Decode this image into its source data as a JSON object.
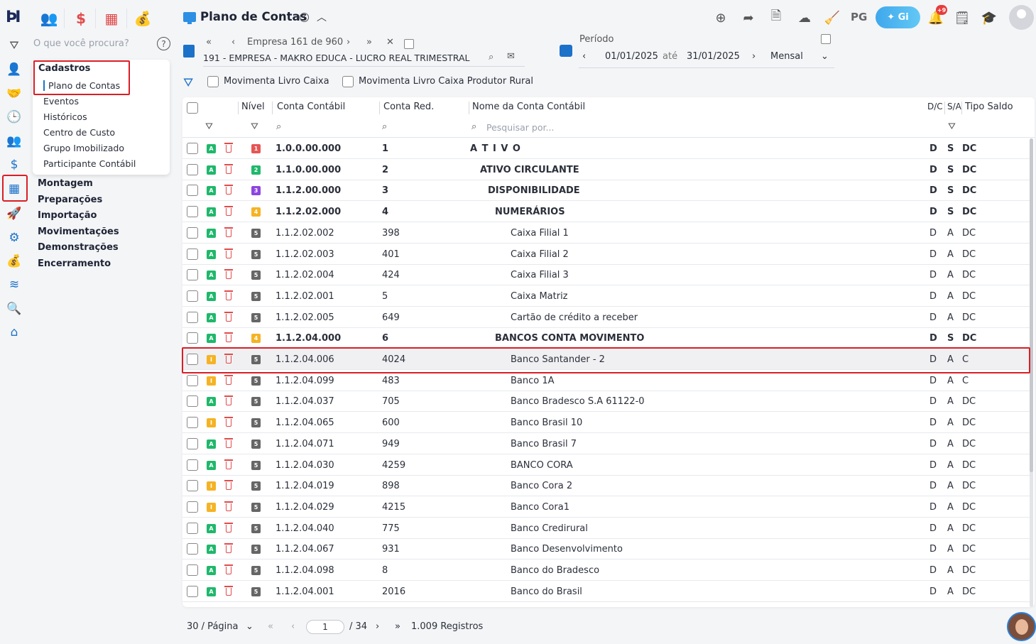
{
  "header": {
    "page_title": "Plano de Contas",
    "pg_label": "PG",
    "gi_label": "Gi",
    "notif_badge": "+9"
  },
  "sidebar": {
    "search_placeholder": "O que você procura?",
    "submenu": {
      "category": "Cadastros",
      "items": [
        "Plano de Contas",
        "Eventos",
        "Históricos",
        "Centro de Custo",
        "Grupo Imobilizado",
        "Participante Contábil"
      ]
    },
    "main_items": [
      "Montagem",
      "Preparações",
      "Importação",
      "Movimentações",
      "Demonstrações",
      "Encerramento"
    ]
  },
  "company": {
    "nav_label": "Empresa 161 de 960",
    "name": "191 - EMPRESA - MAKRO EDUCA - LUCRO REAL TRIMESTRAL"
  },
  "period": {
    "label": "Período",
    "start": "01/01/2025",
    "sep": "até",
    "end": "31/01/2025",
    "mode": "Mensal"
  },
  "filters": {
    "caixa": "Movimenta Livro Caixa",
    "caixa_rural": "Movimenta Livro Caixa Produtor Rural"
  },
  "table": {
    "headers": {
      "nivel": "Nível",
      "conta": "Conta Contábil",
      "red": "Conta Red.",
      "nome": "Nome da Conta Contábil",
      "dc": "D/C",
      "sa": "S/A",
      "tipo": "Tipo Saldo"
    },
    "search_placeholder": "Pesquisar por...",
    "rows": [
      {
        "status": "A",
        "nivel": "1",
        "conta": "1.0.0.00.000",
        "red": "1",
        "nome": "A T I V O",
        "dc": "D",
        "sa": "S",
        "tipo": "DC"
      },
      {
        "status": "A",
        "nivel": "2",
        "conta": "1.1.0.00.000",
        "red": "2",
        "nome": "ATIVO CIRCULANTE",
        "dc": "D",
        "sa": "S",
        "tipo": "DC"
      },
      {
        "status": "A",
        "nivel": "3",
        "conta": "1.1.2.00.000",
        "red": "3",
        "nome": "DISPONIBILIDADE",
        "dc": "D",
        "sa": "S",
        "tipo": "DC"
      },
      {
        "status": "A",
        "nivel": "4",
        "conta": "1.1.2.02.000",
        "red": "4",
        "nome": "NUMERÁRIOS",
        "dc": "D",
        "sa": "S",
        "tipo": "DC"
      },
      {
        "status": "A",
        "nivel": "5",
        "conta": "1.1.2.02.002",
        "red": "398",
        "nome": "Caixa Filial 1",
        "dc": "D",
        "sa": "A",
        "tipo": "DC"
      },
      {
        "status": "A",
        "nivel": "5",
        "conta": "1.1.2.02.003",
        "red": "401",
        "nome": "Caixa Filial 2",
        "dc": "D",
        "sa": "A",
        "tipo": "DC"
      },
      {
        "status": "A",
        "nivel": "5",
        "conta": "1.1.2.02.004",
        "red": "424",
        "nome": "Caixa Filial 3",
        "dc": "D",
        "sa": "A",
        "tipo": "DC"
      },
      {
        "status": "A",
        "nivel": "5",
        "conta": "1.1.2.02.001",
        "red": "5",
        "nome": "Caixa Matriz",
        "dc": "D",
        "sa": "A",
        "tipo": "DC"
      },
      {
        "status": "A",
        "nivel": "5",
        "conta": "1.1.2.02.005",
        "red": "649",
        "nome": "Cartão de crédito a receber",
        "dc": "D",
        "sa": "A",
        "tipo": "DC"
      },
      {
        "status": "A",
        "nivel": "4",
        "conta": "1.1.2.04.000",
        "red": "6",
        "nome": "BANCOS CONTA MOVIMENTO",
        "dc": "D",
        "sa": "S",
        "tipo": "DC"
      },
      {
        "status": "I",
        "nivel": "5",
        "conta": "1.1.2.04.006",
        "red": "4024",
        "nome": "Banco Santander - 2",
        "dc": "D",
        "sa": "A",
        "tipo": "C"
      },
      {
        "status": "I",
        "nivel": "5",
        "conta": "1.1.2.04.099",
        "red": "483",
        "nome": "Banco 1A",
        "dc": "D",
        "sa": "A",
        "tipo": "C"
      },
      {
        "status": "A",
        "nivel": "5",
        "conta": "1.1.2.04.037",
        "red": "705",
        "nome": "Banco Bradesco S.A 61122-0",
        "dc": "D",
        "sa": "A",
        "tipo": "DC"
      },
      {
        "status": "I",
        "nivel": "5",
        "conta": "1.1.2.04.065",
        "red": "600",
        "nome": "Banco Brasil 10",
        "dc": "D",
        "sa": "A",
        "tipo": "DC"
      },
      {
        "status": "A",
        "nivel": "5",
        "conta": "1.1.2.04.071",
        "red": "949",
        "nome": "Banco Brasil 7",
        "dc": "D",
        "sa": "A",
        "tipo": "DC"
      },
      {
        "status": "A",
        "nivel": "5",
        "conta": "1.1.2.04.030",
        "red": "4259",
        "nome": "BANCO CORA",
        "dc": "D",
        "sa": "A",
        "tipo": "DC"
      },
      {
        "status": "I",
        "nivel": "5",
        "conta": "1.1.2.04.019",
        "red": "898",
        "nome": "Banco Cora 2",
        "dc": "D",
        "sa": "A",
        "tipo": "DC"
      },
      {
        "status": "I",
        "nivel": "5",
        "conta": "1.1.2.04.029",
        "red": "4215",
        "nome": "Banco Cora1",
        "dc": "D",
        "sa": "A",
        "tipo": "DC"
      },
      {
        "status": "A",
        "nivel": "5",
        "conta": "1.1.2.04.040",
        "red": "775",
        "nome": "Banco Credirural",
        "dc": "D",
        "sa": "A",
        "tipo": "DC"
      },
      {
        "status": "A",
        "nivel": "5",
        "conta": "1.1.2.04.067",
        "red": "931",
        "nome": "Banco Desenvolvimento",
        "dc": "D",
        "sa": "A",
        "tipo": "DC"
      },
      {
        "status": "A",
        "nivel": "5",
        "conta": "1.1.2.04.098",
        "red": "8",
        "nome": "Banco do Bradesco",
        "dc": "D",
        "sa": "A",
        "tipo": "DC"
      },
      {
        "status": "A",
        "nivel": "5",
        "conta": "1.1.2.04.001",
        "red": "2016",
        "nome": "Banco do Brasil",
        "dc": "D",
        "sa": "A",
        "tipo": "DC"
      }
    ]
  },
  "pagination": {
    "per_page": "30 / Página",
    "current": "1",
    "total": "/ 34",
    "records": "1.009 Registros"
  },
  "colors": {
    "accent": "#1c72c8",
    "highlight": "#d91e26",
    "active_status": "#1fb86b",
    "inactive_status": "#f5b324"
  }
}
